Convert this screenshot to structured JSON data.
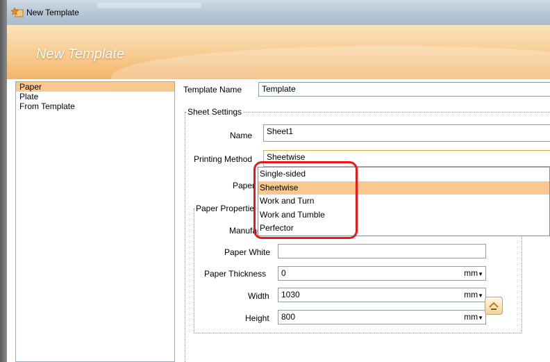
{
  "window": {
    "title": "New Template",
    "banner_title": "New Template"
  },
  "nav": {
    "items": [
      {
        "label": "Paper",
        "selected": true
      },
      {
        "label": "Plate",
        "selected": false
      },
      {
        "label": "From Template",
        "selected": false
      }
    ]
  },
  "template": {
    "name_label": "Template Name",
    "name_value": "Template"
  },
  "sheet_settings": {
    "group_title": "Sheet Settings",
    "name_label": "Name",
    "name_value": "Sheet1",
    "printing_method_label": "Printing Method",
    "printing_method_value": "Sheetwise",
    "paper_label": "Paper"
  },
  "dropdown": {
    "options": [
      {
        "label": "Single-sided",
        "selected": false
      },
      {
        "label": "Sheetwise",
        "selected": true
      },
      {
        "label": "Work and Turn",
        "selected": false
      },
      {
        "label": "Work and Tumble",
        "selected": false
      },
      {
        "label": "Perfector",
        "selected": false
      }
    ]
  },
  "paper_properties": {
    "group_title": "Paper Propertie",
    "manufacturer_label": "Manufactu",
    "paper_white_label": "Paper White",
    "paper_white_value": "",
    "thickness_label": "Paper Thickness",
    "thickness_value": "0",
    "thickness_unit": "mm",
    "width_label": "Width",
    "width_value": "1030",
    "width_unit": "mm",
    "height_label": "Height",
    "height_value": "800",
    "height_unit": "mm"
  },
  "colors": {
    "selection": "#f8c88e",
    "highlight_ring": "#e81818",
    "focus_border": "#e9a558"
  },
  "icons": {
    "app": "template-star-icon",
    "swap": "swap-dimensions-icon"
  }
}
